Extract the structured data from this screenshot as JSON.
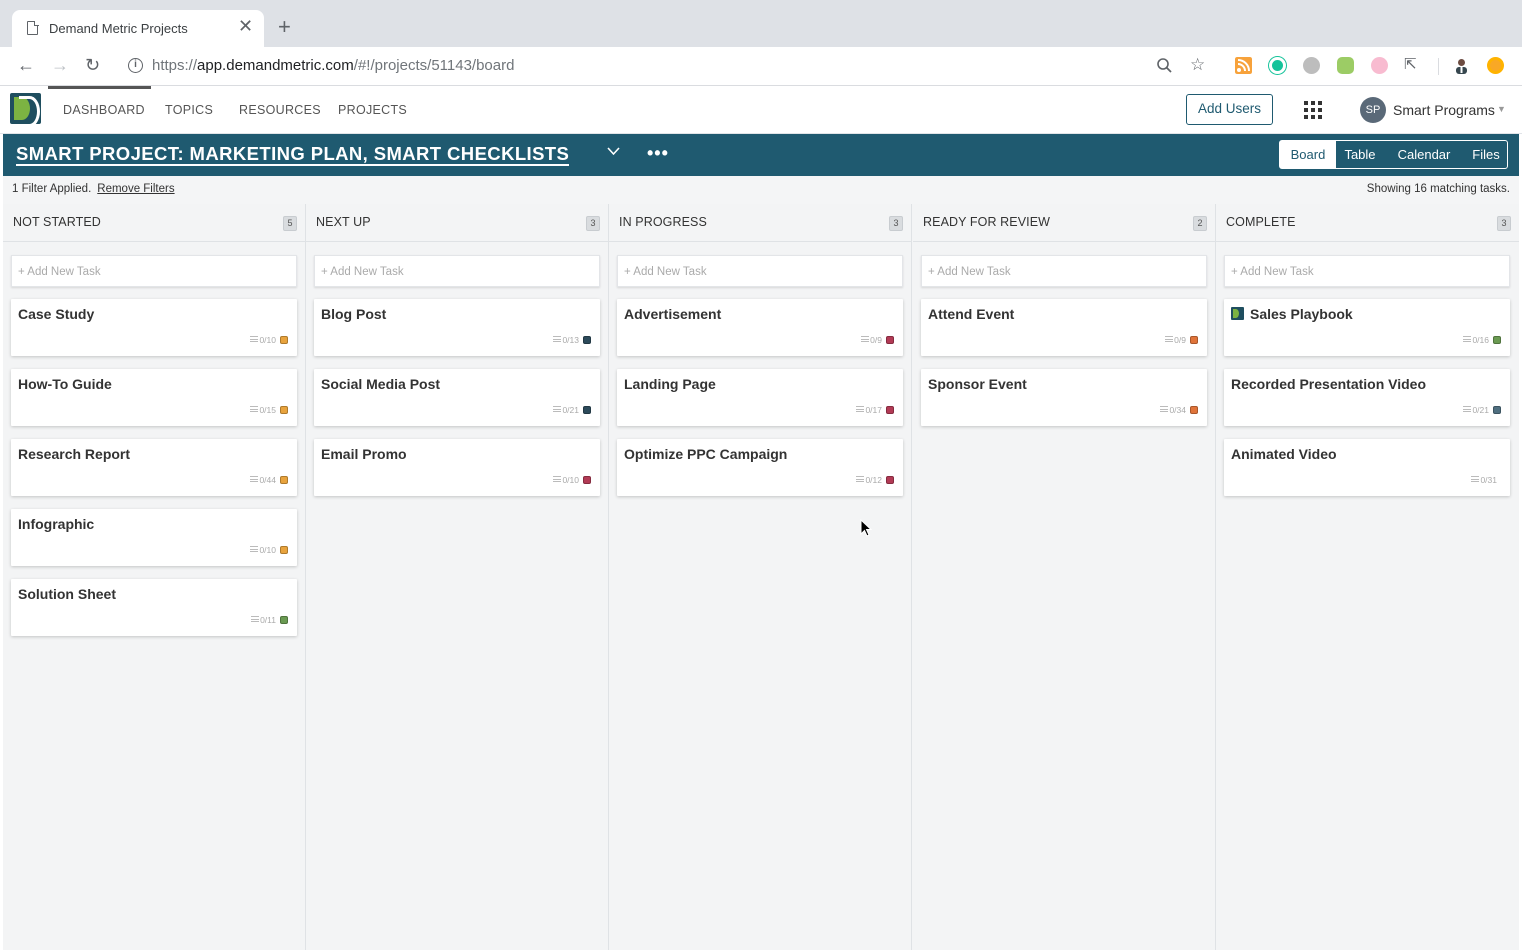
{
  "browser": {
    "tab_title": "Demand Metric Projects",
    "close_glyph": "✕",
    "new_tab_glyph": "+",
    "url_prefix": "https://",
    "url_host": "app.demandmetric.com",
    "url_path": "/#!/projects/51143/board"
  },
  "nav": {
    "items": [
      "DASHBOARD",
      "TOPICS",
      "RESOURCES",
      "PROJECTS"
    ],
    "add_users": "Add Users",
    "avatar_initials": "SP",
    "user_name": "Smart Programs"
  },
  "project": {
    "title": "SMART PROJECT: MARKETING PLAN, SMART CHECKLISTS",
    "more": "•••",
    "views": [
      "Board",
      "Table",
      "Calendar",
      "Files"
    ],
    "active_view": "Board"
  },
  "filter": {
    "applied": "1 Filter Applied.",
    "remove": "Remove Filters",
    "showing": "Showing 16 matching tasks."
  },
  "colors": {
    "brand": "#1f5a70",
    "orange": "#e8a33d",
    "navy": "#2c4a5a",
    "crimson": "#b23a55",
    "coral": "#e0743a",
    "green": "#6a9a52",
    "steel": "#4f6f80"
  },
  "board": {
    "add_task_label": "+ Add New Task",
    "columns": [
      {
        "title": "NOT STARTED",
        "count": "5",
        "cards": [
          {
            "title": "Case Study",
            "checklist": "0/10",
            "dot": "#e8a33d"
          },
          {
            "title": "How-To Guide",
            "checklist": "0/15",
            "dot": "#e8a33d"
          },
          {
            "title": "Research Report",
            "checklist": "0/44",
            "dot": "#e8a33d"
          },
          {
            "title": "Infographic",
            "checklist": "0/10",
            "dot": "#e8a33d"
          },
          {
            "title": "Solution Sheet",
            "checklist": "0/11",
            "dot": "#6a9a52"
          }
        ]
      },
      {
        "title": "NEXT UP",
        "count": "3",
        "cards": [
          {
            "title": "Blog Post",
            "checklist": "0/13",
            "dot": "#2c4a5a"
          },
          {
            "title": "Social Media Post",
            "checklist": "0/21",
            "dot": "#2c4a5a"
          },
          {
            "title": "Email Promo",
            "checklist": "0/10",
            "dot": "#b23a55"
          }
        ]
      },
      {
        "title": "IN PROGRESS",
        "count": "3",
        "cards": [
          {
            "title": "Advertisement",
            "checklist": "0/9",
            "dot": "#b23a55"
          },
          {
            "title": "Landing Page",
            "checklist": "0/17",
            "dot": "#b23a55"
          },
          {
            "title": "Optimize PPC Campaign",
            "checklist": "0/12",
            "dot": "#b23a55"
          }
        ]
      },
      {
        "title": "READY FOR REVIEW",
        "count": "2",
        "cards": [
          {
            "title": "Attend Event",
            "checklist": "0/9",
            "dot": "#e0743a"
          },
          {
            "title": "Sponsor Event",
            "checklist": "0/34",
            "dot": "#e0743a"
          }
        ]
      },
      {
        "title": "COMPLETE",
        "count": "3",
        "cards": [
          {
            "title": "Sales Playbook",
            "checklist": "0/16",
            "dot": "#6a9a52",
            "logo": true
          },
          {
            "title": "Recorded Presentation Video",
            "checklist": "0/21",
            "dot": "#4f6f80"
          },
          {
            "title": "Animated Video",
            "checklist": "0/31",
            "dot": ""
          }
        ]
      }
    ]
  }
}
